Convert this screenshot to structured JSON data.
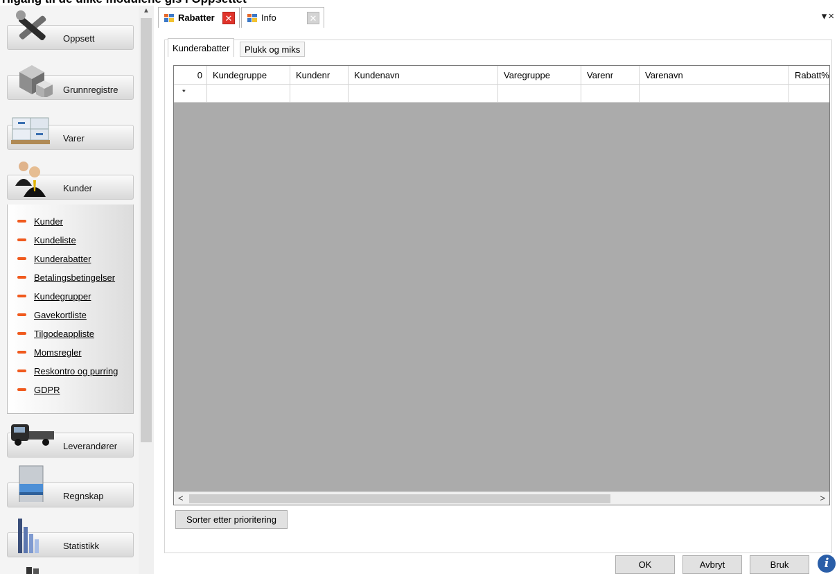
{
  "page_heading": "Tilgang til de ulike modulene gis i Oppsettet",
  "sidebar": {
    "nav": [
      {
        "label": "Oppsett",
        "icon": "tools-icon"
      },
      {
        "label": "Grunnregistre",
        "icon": "cubes-icon"
      },
      {
        "label": "Varer",
        "icon": "pallet-boxes-icon"
      },
      {
        "label": "Kunder",
        "icon": "customers-icon"
      },
      {
        "label": "Leverandører",
        "icon": "truck-icon"
      },
      {
        "label": "Regnskap",
        "icon": "cabinet-icon"
      },
      {
        "label": "Statistikk",
        "icon": "bar-chart-icon"
      }
    ],
    "kunder_items": [
      "Kunder",
      "Kundeliste",
      "Kunderabatter",
      "Betalingsbetingelser",
      "Kundegrupper",
      "Gavekortliste",
      "Tilgodeappliste",
      "Momsregler",
      "Reskontro og purring",
      "GDPR"
    ],
    "accent_color": "#f05a1e"
  },
  "doc_tabs": [
    {
      "label": "Rabatter",
      "active": true,
      "close_color": "#e0342b"
    },
    {
      "label": "Info",
      "active": false,
      "close_color": "#c8c8c8"
    }
  ],
  "strip_tools": "▾×",
  "sub_tabs": [
    "Kunderabatter",
    "Plukk og miks"
  ],
  "grid": {
    "columns": [
      "0",
      "Kundegruppe",
      "Kundenr",
      "Kundenavn",
      "Varegruppe",
      "Varenr",
      "Varenavn",
      "Rabatt%"
    ],
    "new_row_marker": "*"
  },
  "buttons": {
    "sort": "Sorter etter prioritering",
    "ok": "OK",
    "cancel": "Avbryt",
    "apply": "Bruk",
    "info": "i"
  }
}
